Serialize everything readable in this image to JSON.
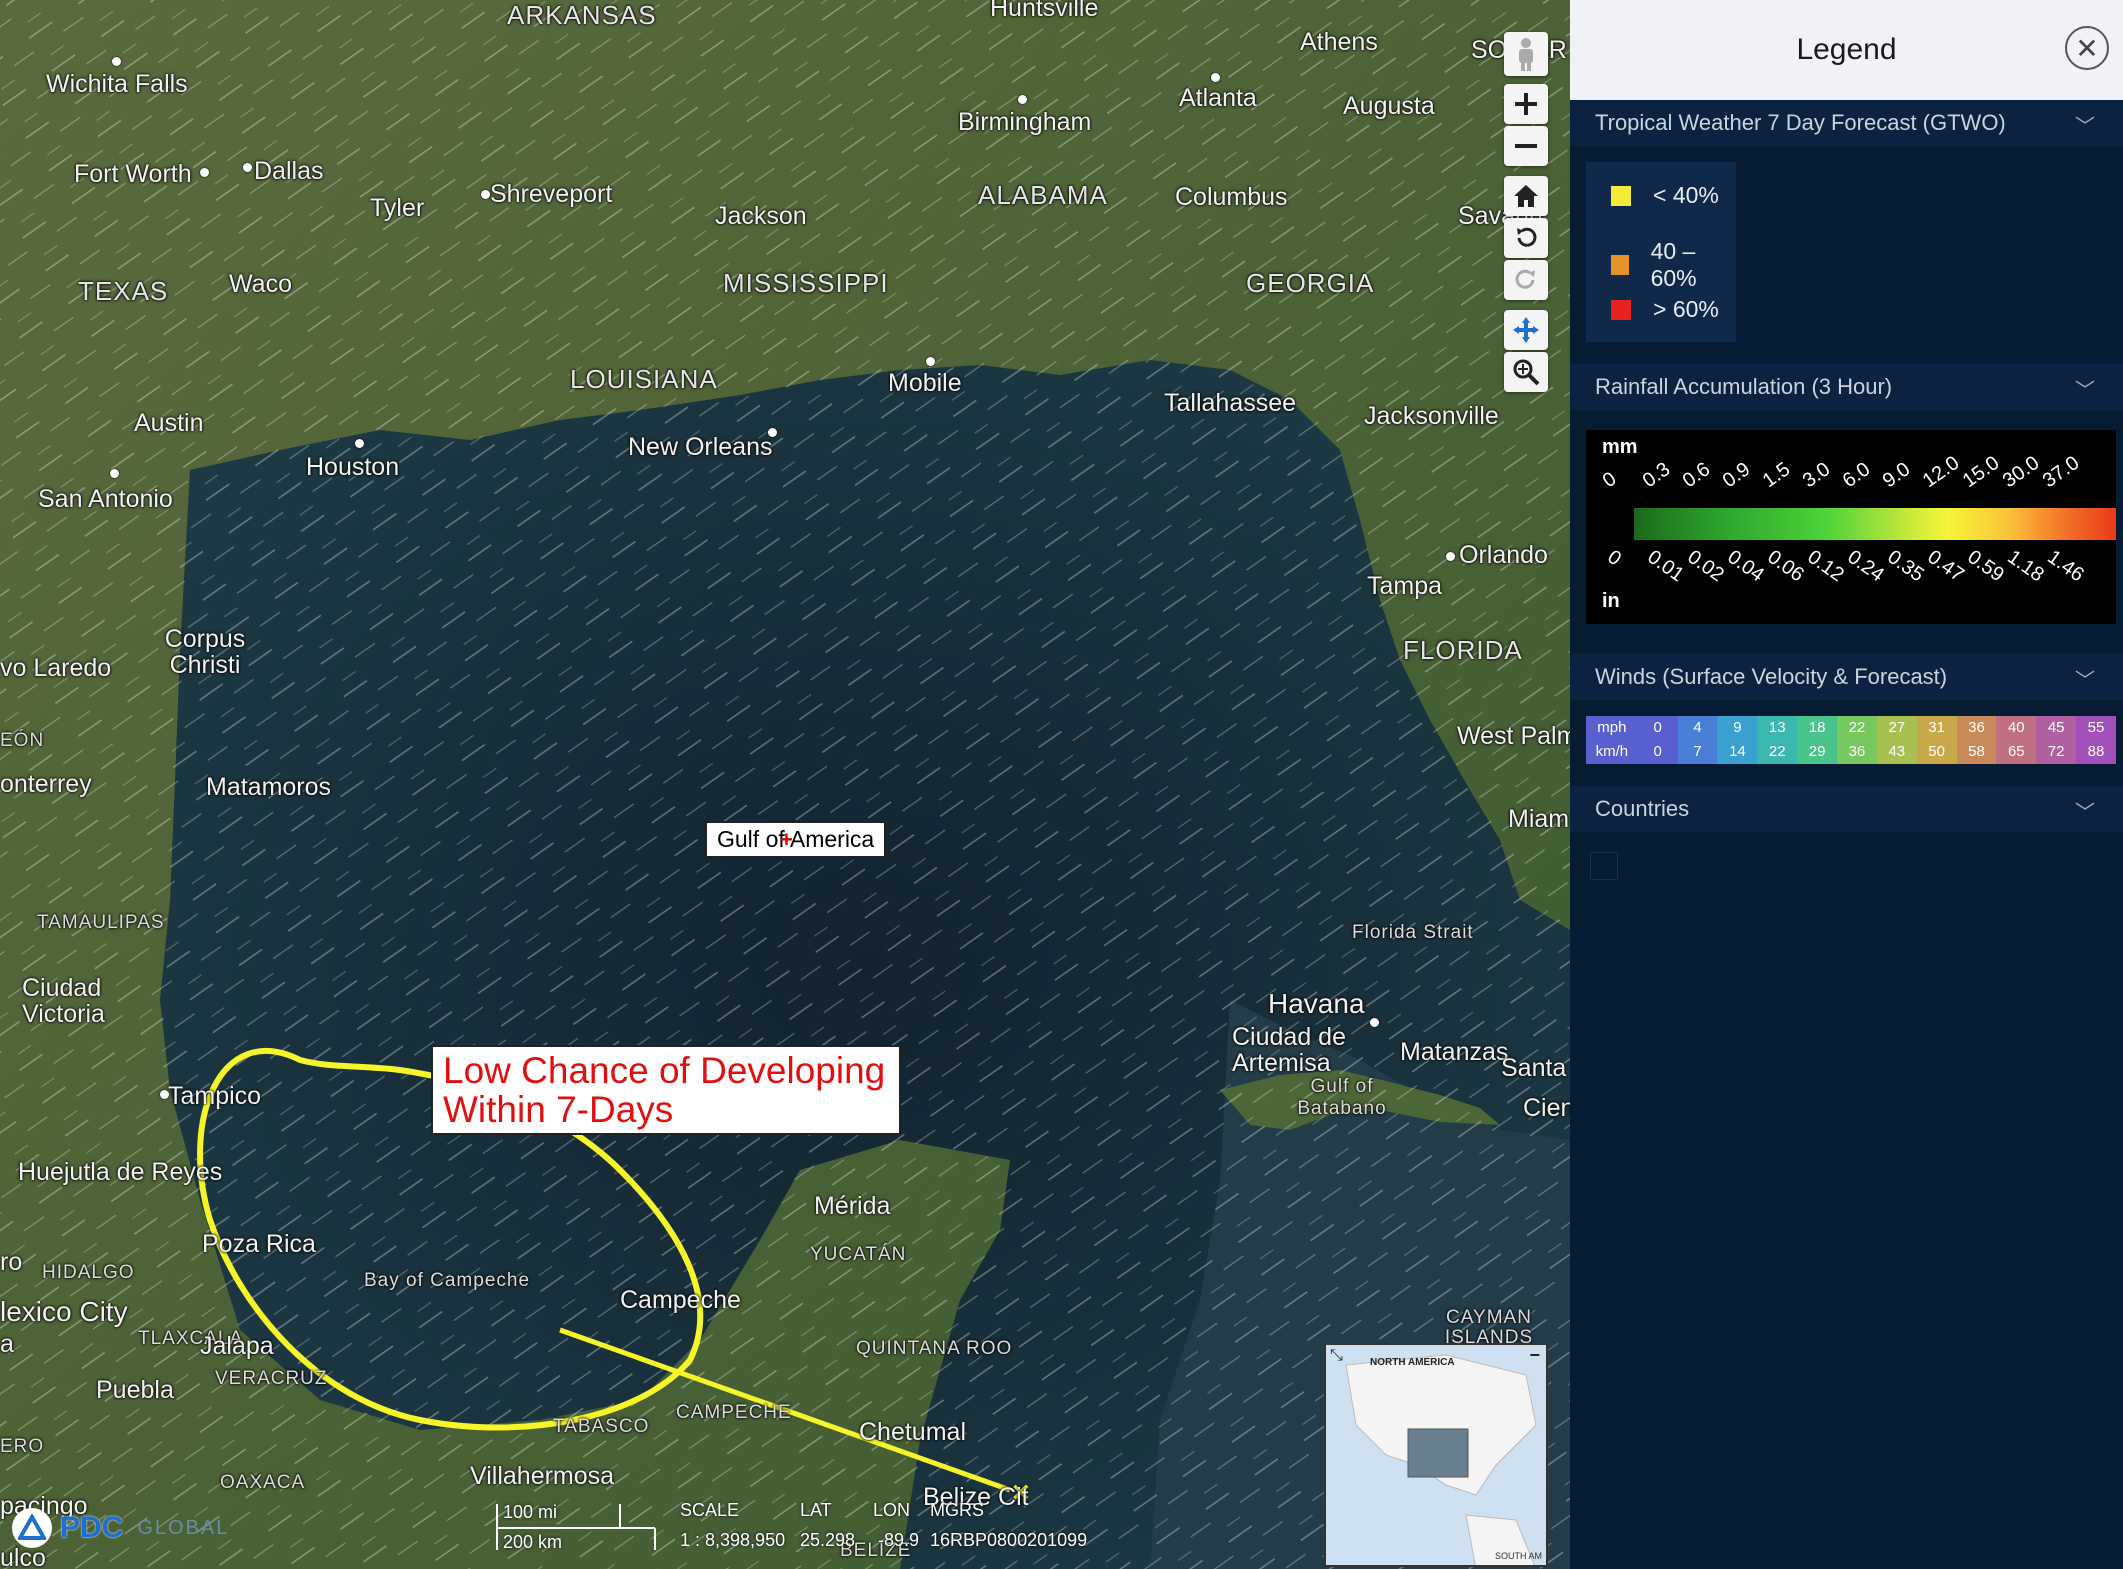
{
  "map": {
    "states": [
      "ARKANSAS",
      "TEXAS",
      "LOUISIANA",
      "MISSISSIPPI",
      "ALABAMA",
      "GEORGIA",
      "FLORIDA",
      "YUCATÁN",
      "QUINTANA ROO",
      "CAMPECHE",
      "TABASCO",
      "OAXACA",
      "VERACRUZ",
      "TLAXCALA",
      "HIDALGO",
      "TAMAULIPAS",
      "CAYMAN ISLANDS",
      "BELIZE"
    ],
    "cities": [
      "Wichita Falls",
      "Fort Worth",
      "Dallas",
      "Tyler",
      "Shreveport",
      "Jackson",
      "Birmingham",
      "Huntsville",
      "Athens",
      "Atlanta",
      "Augusta",
      "Columbus",
      "Savann",
      "SO CAR",
      "Waco",
      "Austin",
      "San Antonio",
      "Houston",
      "New Orleans",
      "Mobile",
      "Tallahassee",
      "Jacksonville",
      "Orlando",
      "Tampa",
      "West Palm",
      "Miam",
      "Corpus Christi",
      "vo Laredo",
      "onterrey",
      "Matamoros",
      "EÓN",
      "Ciudad Victoria",
      "Tampico",
      "Huejutla de Reyes",
      "Poza Rica",
      "lexico City",
      "Jalapa",
      "Puebla",
      "Villahermosa",
      "Campeche",
      "Mérida",
      "Chetumal",
      "Belize Cit",
      "Havana",
      "Ciudad de Artemisa",
      "Matanzas",
      "Santa",
      "Cien",
      "pacingo",
      "ulco",
      "ERO",
      "ro",
      "a"
    ],
    "water": [
      "Florida Strait",
      "Gulf of Batabano",
      "Bay of Campeche"
    ],
    "gulf_label": "Gulf of America",
    "callout": [
      "Low Chance of Developing",
      "Within 7-Days"
    ],
    "scale": {
      "mi": "100 mi",
      "km": "200 km"
    },
    "status": {
      "scale_label": "SCALE",
      "scale_value": "1 : 8,398,950",
      "lat_label": "LAT",
      "lat_value": "25.298",
      "lon_label": "LON",
      "lon_value": "-89.9",
      "mgrs_label": "MGRS",
      "mgrs_value": "16RBP0800201099"
    },
    "minimap": {
      "title": "NORTH AMERICA",
      "south": "SOUTH AM"
    },
    "logo": {
      "text": "PDC",
      "sub": "GLOBAL"
    },
    "toolbar": [
      "streetview-icon",
      "zoom-in-icon",
      "zoom-out-icon",
      "home-icon",
      "rotate-left-icon",
      "rotate-right-icon",
      "pan-icon",
      "zoom-area-icon"
    ]
  },
  "legend": {
    "title": "Legend",
    "sections": {
      "gtwo": {
        "title": "Tropical Weather 7 Day Forecast (GTWO)",
        "items": [
          {
            "label": "< 40%",
            "color": "#f5e93a"
          },
          {
            "label": "40 – 60%",
            "color": "#e8922a"
          },
          {
            "label": "> 60%",
            "color": "#e82020"
          }
        ]
      },
      "rain": {
        "title": "Rainfall Accumulation (3 Hour)",
        "unit_top": "mm",
        "unit_bottom": "in",
        "mm": [
          "0",
          "0.3",
          "0.6",
          "0.9",
          "1.5",
          "3.0",
          "6.0",
          "9.0",
          "12.0",
          "15.0",
          "30.0",
          "37.0"
        ],
        "inch": [
          "0",
          "0.01",
          "0.02",
          "0.04",
          "0.06",
          "0.12",
          "0.24",
          "0.35",
          "0.47",
          "0.59",
          "1.18",
          "1.46"
        ]
      },
      "winds": {
        "title": "Winds (Surface Velocity & Forecast)",
        "mph_label": "mph",
        "kmh_label": "km/h",
        "mph": [
          "0",
          "4",
          "9",
          "13",
          "18",
          "22",
          "27",
          "31",
          "36",
          "40",
          "45",
          "55"
        ],
        "kmh": [
          "0",
          "7",
          "14",
          "22",
          "29",
          "36",
          "43",
          "50",
          "58",
          "65",
          "72",
          "88"
        ],
        "colors": [
          "#5a5fd0",
          "#4a7fd8",
          "#3aa0d0",
          "#3ab8b0",
          "#48c48a",
          "#78c860",
          "#a8c050",
          "#c8a848",
          "#c88a58",
          "#c07080",
          "#b060a0",
          "#a050b8"
        ]
      },
      "countries": {
        "title": "Countries"
      }
    }
  }
}
